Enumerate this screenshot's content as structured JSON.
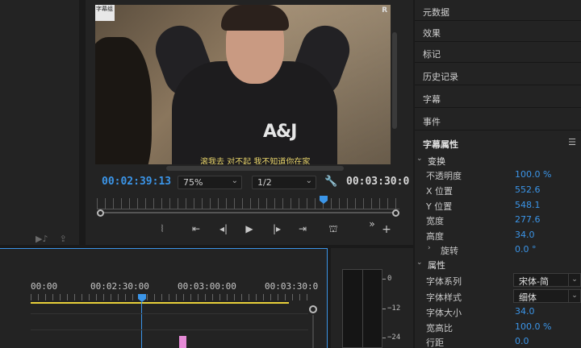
{
  "left_panel": {
    "icons": [
      "audio-clip-icon",
      "export-frame-icon"
    ]
  },
  "monitor": {
    "watermark": "字幕组",
    "corner_mark": "R",
    "shirt_logo": "A&J",
    "subtitle": "滚我去 对不起 我不知道你在家",
    "timecode_current": "00:02:39:13",
    "timecode_duration": "00:03:30:0",
    "zoom": "75%",
    "resolution": "1/2",
    "transport": [
      "mark-in-icon",
      "go-to-in-icon",
      "step-back-icon",
      "play-icon",
      "step-forward-icon",
      "go-to-out-icon",
      "export-frame-icon",
      "more-icon",
      "add-icon"
    ],
    "playhead_fraction": 0.74
  },
  "right_panel": {
    "items": [
      "元数据",
      "效果",
      "标记",
      "历史记录",
      "字幕",
      "事件"
    ],
    "header": "字幕属性",
    "sections": {
      "transform": {
        "title": "变换",
        "props": [
          {
            "label": "不透明度",
            "value": "100.0 %"
          },
          {
            "label": "X 位置",
            "value": "552.6"
          },
          {
            "label": "Y 位置",
            "value": "548.1"
          },
          {
            "label": "宽度",
            "value": "277.6"
          },
          {
            "label": "高度",
            "value": "34.0"
          },
          {
            "label": "旋转",
            "value": "0.0 °"
          }
        ]
      },
      "attributes": {
        "title": "属性",
        "font_family_label": "字体系列",
        "font_family_value": "宋体-简",
        "font_style_label": "字体样式",
        "font_style_value": "细体",
        "props": [
          {
            "label": "字体大小",
            "value": "34.0"
          },
          {
            "label": "宽高比",
            "value": "100.0 %"
          },
          {
            "label": "行距",
            "value": "0.0"
          }
        ]
      }
    }
  },
  "timeline": {
    "ruler_labels": [
      "00:00",
      "00:02:30:00",
      "00:03:00:00",
      "00:03:30:0"
    ]
  },
  "meter": {
    "scale": [
      "0",
      "−12",
      "−24"
    ]
  },
  "colors": {
    "accent": "#3b95e8",
    "workarea": "#e8d03a",
    "clip": "#e58ad6",
    "panel": "#232323"
  }
}
